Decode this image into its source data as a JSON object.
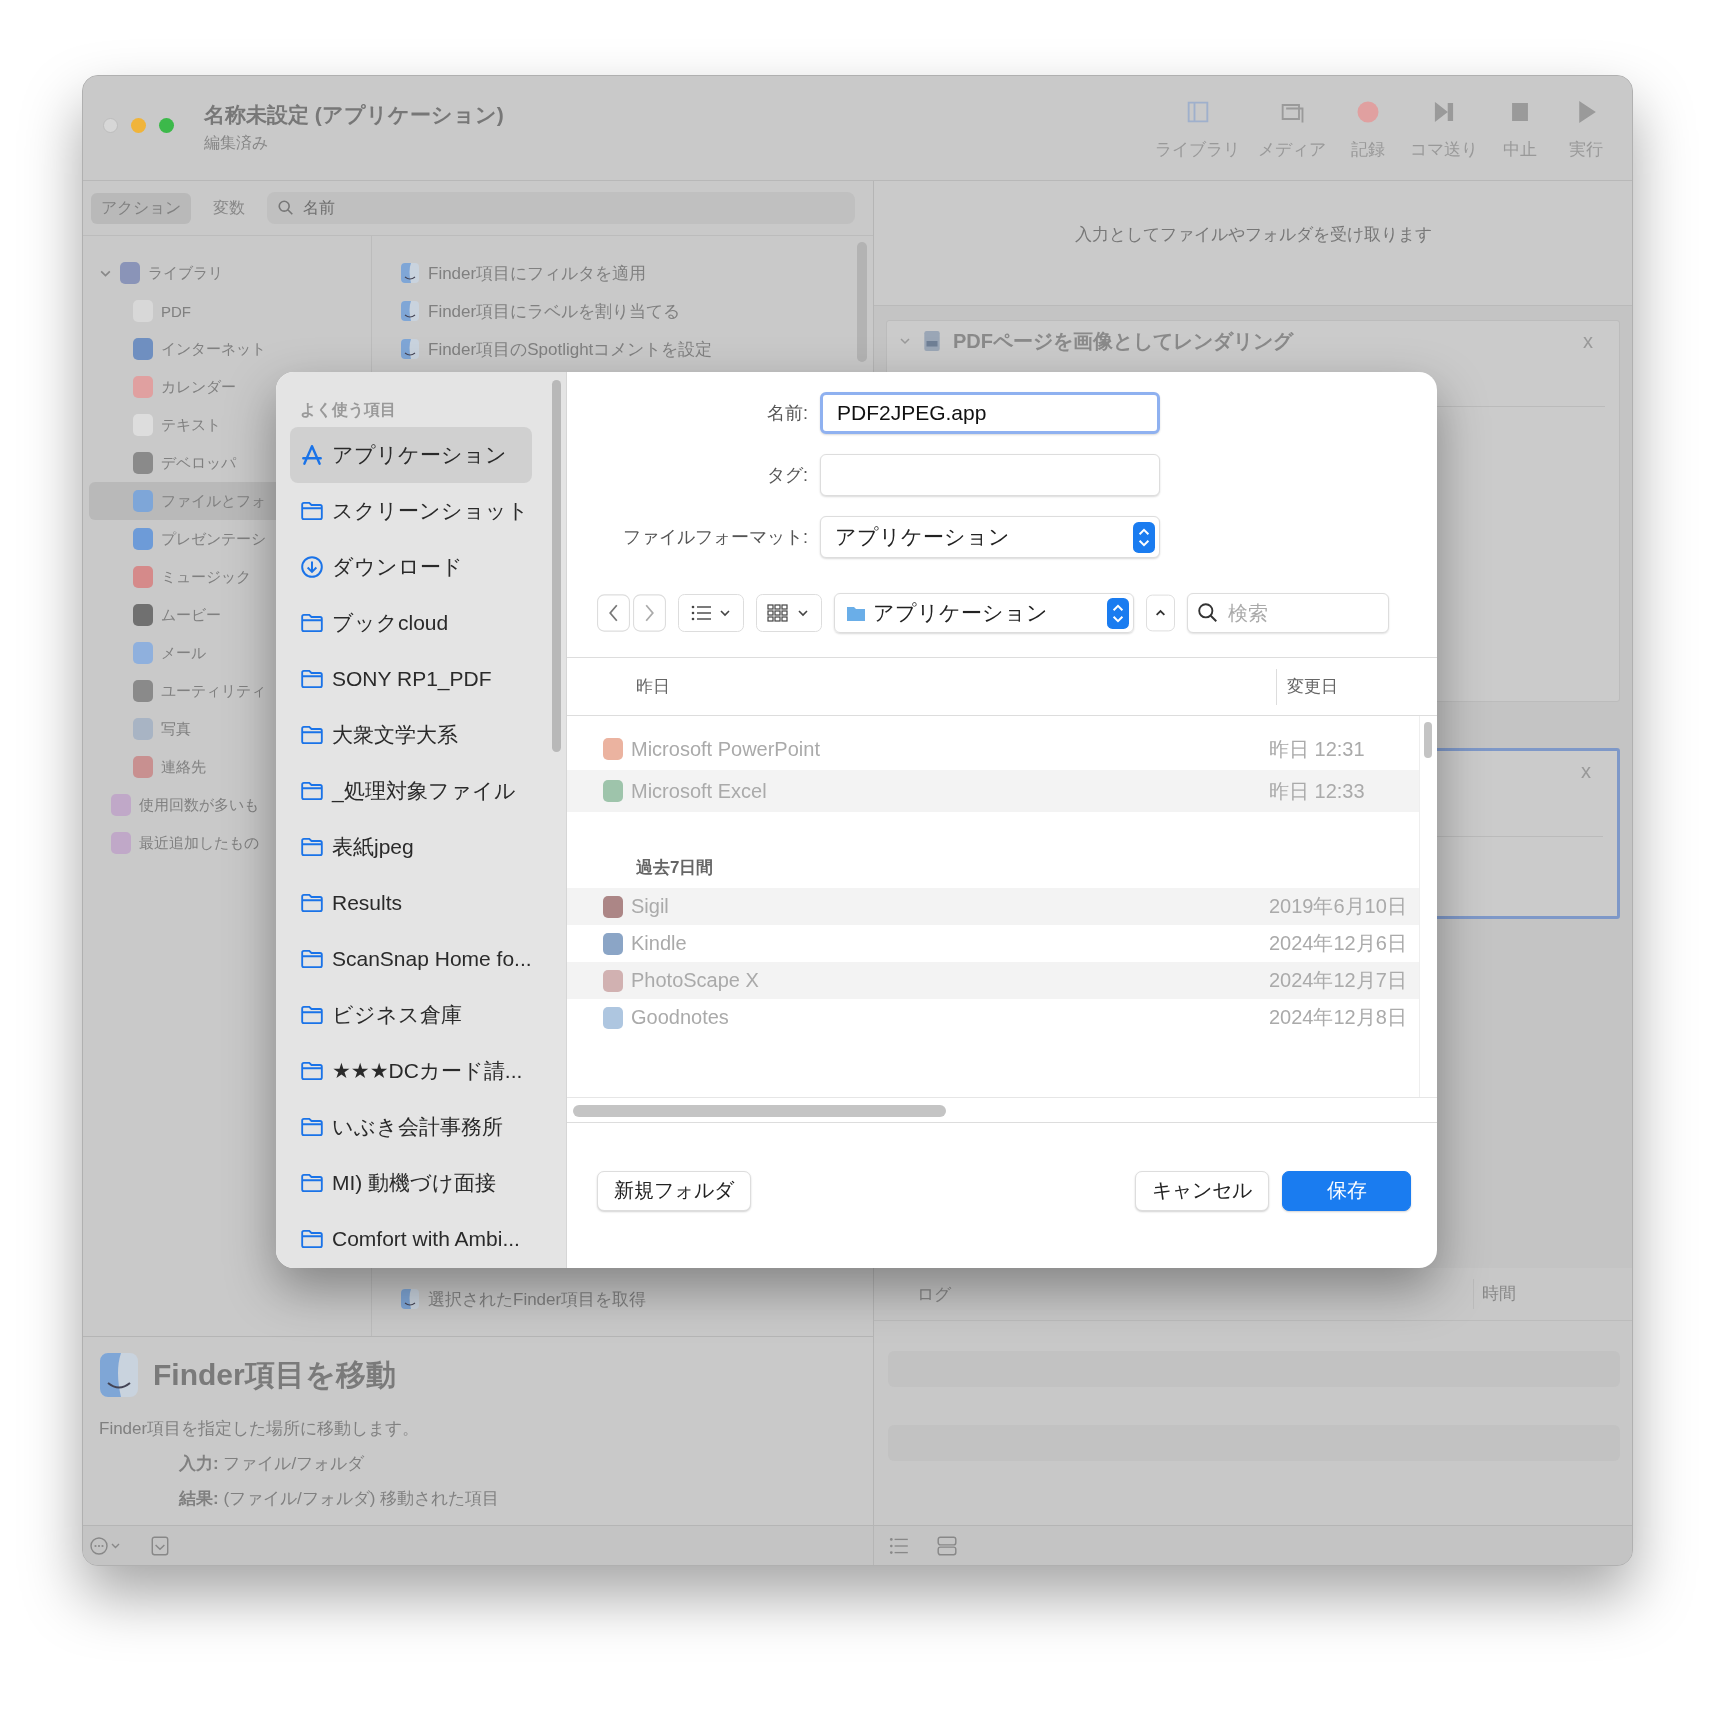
{
  "window": {
    "title": "名称未設定 (アプリケーション)",
    "subtitle": "編集済み"
  },
  "toolbar": [
    {
      "label": "ライブラリ",
      "kind": "library"
    },
    {
      "label": "メディア",
      "kind": "media"
    },
    {
      "label": "記録",
      "kind": "record"
    },
    {
      "label": "コマ送り",
      "kind": "step"
    },
    {
      "label": "中止",
      "kind": "stop"
    },
    {
      "label": "実行",
      "kind": "run"
    }
  ],
  "left_tabs": [
    {
      "label": "アクション",
      "selected": true
    },
    {
      "label": "変数",
      "selected": false
    }
  ],
  "search": {
    "placeholder": "名前"
  },
  "library": [
    {
      "label": "ライブラリ",
      "kind": "library",
      "expanded": true,
      "selected": false,
      "children": [
        {
          "label": "PDF",
          "kind": "pdf",
          "selected": false
        },
        {
          "label": "インターネット",
          "kind": "internet",
          "selected": false
        },
        {
          "label": "カレンダー",
          "kind": "calendar",
          "selected": false
        },
        {
          "label": "テキスト",
          "kind": "text",
          "selected": false
        },
        {
          "label": "デベロッパ",
          "kind": "tools",
          "selected": false
        },
        {
          "label": "ファイルとフォ",
          "kind": "finder",
          "selected": true
        },
        {
          "label": "プレゼンテーシ",
          "kind": "presentation",
          "selected": false
        },
        {
          "label": "ミュージック",
          "kind": "music",
          "selected": false
        },
        {
          "label": "ムービー",
          "kind": "movie",
          "selected": false
        },
        {
          "label": "メール",
          "kind": "mail",
          "selected": false
        },
        {
          "label": "ユーティリティ",
          "kind": "tools",
          "selected": false
        },
        {
          "label": "写真",
          "kind": "photo",
          "selected": false
        },
        {
          "label": "連絡先",
          "kind": "contacts",
          "selected": false
        }
      ]
    },
    {
      "label": "使用回数が多いも",
      "kind": "smart",
      "selected": false
    },
    {
      "label": "最近追加したもの",
      "kind": "smart",
      "selected": false
    }
  ],
  "actions": [
    "Finder項目にフィルタを適用",
    "Finder項目にラベルを割り当てる",
    "Finder項目のSpotlightコメントを設定",
    "選択されたFinder項目を取得"
  ],
  "description": {
    "title": "Finder項目を移動",
    "text": "Finder項目を指定した場所に移動します。",
    "input_label": "入力:",
    "input": "ファイル/フォルダ",
    "result_label": "結果:",
    "result": "(ファイル/フォルダ) 移動された項目"
  },
  "workflow": {
    "input_note": "入力としてファイルやフォルダを受け取ります",
    "actions": [
      {
        "title": "PDFページを画像としてレンダリング",
        "selected": false,
        "close": "x"
      },
      {
        "selected": true,
        "close": "x"
      }
    ]
  },
  "log": {
    "columns": [
      "ログ",
      "時間"
    ]
  },
  "dialog": {
    "sidebar": {
      "section": "よく使う項目",
      "items": [
        {
          "label": "アプリケーション",
          "kind": "app",
          "selected": true
        },
        {
          "label": "スクリーンショット",
          "kind": "folder",
          "selected": false
        },
        {
          "label": "ダウンロード",
          "kind": "download",
          "selected": false
        },
        {
          "label": "ブックcloud",
          "kind": "folder",
          "selected": false
        },
        {
          "label": "SONY RP1_PDF",
          "kind": "folder",
          "selected": false
        },
        {
          "label": "大衆文学大系",
          "kind": "folder",
          "selected": false
        },
        {
          "label": "_処理対象ファイル",
          "kind": "folder",
          "selected": false
        },
        {
          "label": "表紙jpeg",
          "kind": "folder",
          "selected": false
        },
        {
          "label": "Results",
          "kind": "folder",
          "selected": false
        },
        {
          "label": "ScanSnap Home fo...",
          "kind": "folder",
          "selected": false
        },
        {
          "label": "ビジネス倉庫",
          "kind": "folder",
          "selected": false
        },
        {
          "label": "★★★DCカード請...",
          "kind": "folder",
          "selected": false
        },
        {
          "label": "いぶき会計事務所",
          "kind": "folder",
          "selected": false
        },
        {
          "label": "MI) 動機づけ面接",
          "kind": "folder",
          "selected": false
        },
        {
          "label": "Comfort with Ambi...",
          "kind": "folder",
          "selected": false
        }
      ]
    },
    "name_label": "名前:",
    "name": "PDF2JPEG.app",
    "tag_label": "タグ:",
    "format_label": "ファイルフォーマット:",
    "format": "アプリケーション",
    "location": "アプリケーション",
    "search_placeholder": "検索",
    "columns": [
      "昨日",
      "変更日"
    ],
    "groups": [
      {
        "rows": [
          {
            "name": "Microsoft PowerPoint",
            "date": "昨日 12:31",
            "kind": "powerpoint",
            "disabled": true
          },
          {
            "name": "Microsoft Excel",
            "date": "昨日 12:33",
            "kind": "excel",
            "disabled": true
          }
        ]
      },
      {
        "label": "過去7日間",
        "rows": [
          {
            "name": "Sigil",
            "date": "2019年6月10日",
            "kind": "sigil",
            "disabled": true
          },
          {
            "name": "Kindle",
            "date": "2024年12月6日",
            "kind": "kindle",
            "disabled": true
          },
          {
            "name": "PhotoScape X",
            "date": "2024年12月7日",
            "kind": "photoscape",
            "disabled": true
          },
          {
            "name": "Goodnotes",
            "date": "2024年12月8日",
            "kind": "goodnotes",
            "disabled": true
          }
        ]
      }
    ],
    "buttons": {
      "new_folder": "新規フォルダ",
      "cancel": "キャンセル",
      "save": "保存"
    }
  }
}
